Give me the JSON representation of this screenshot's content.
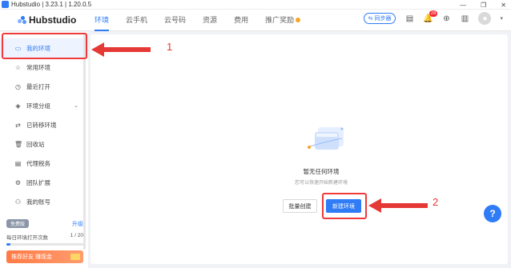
{
  "window": {
    "title": "Hubstudio | 3.23.1 | 1.20.0.5",
    "controls": [
      "—",
      "❐",
      "✕"
    ]
  },
  "brand": {
    "name": "Hubstudio"
  },
  "nav": {
    "tabs": [
      "环境",
      "云手机",
      "云号码",
      "资源",
      "费用",
      "推广奖励"
    ],
    "active": 0
  },
  "header": {
    "sync_label": "同步器",
    "notification_count": "28"
  },
  "sidebar": {
    "items": [
      {
        "label": "我的环境",
        "icon": "▭"
      },
      {
        "label": "常用环境",
        "icon": "☆"
      },
      {
        "label": "最近打开",
        "icon": "◷"
      },
      {
        "label": "环境分组",
        "icon": "◈"
      },
      {
        "label": "已转移环境",
        "icon": "⇄"
      },
      {
        "label": "回收站",
        "icon": "🗑"
      },
      {
        "label": "代理税务",
        "icon": "▤"
      },
      {
        "label": "团队扩展",
        "icon": "⚙"
      },
      {
        "label": "我的账号",
        "icon": "⚇"
      }
    ]
  },
  "plan": {
    "tag": "免费版",
    "upgrade": "升级",
    "quota_label": "每日环境打开次数",
    "quota_value": "1 / 20",
    "quota_fraction": 0.05,
    "promo": "推荐好友 赚现金"
  },
  "empty": {
    "title": "暂无任何环境",
    "subtitle": "您可以快速开始新建环境",
    "batch_button": "批量创建",
    "new_button": "新建环境"
  },
  "help": {
    "label": "?"
  },
  "annotations": {
    "one": "1",
    "two": "2"
  },
  "colors": {
    "accent": "#2f7cf6",
    "highlight": "#f03a3a"
  }
}
